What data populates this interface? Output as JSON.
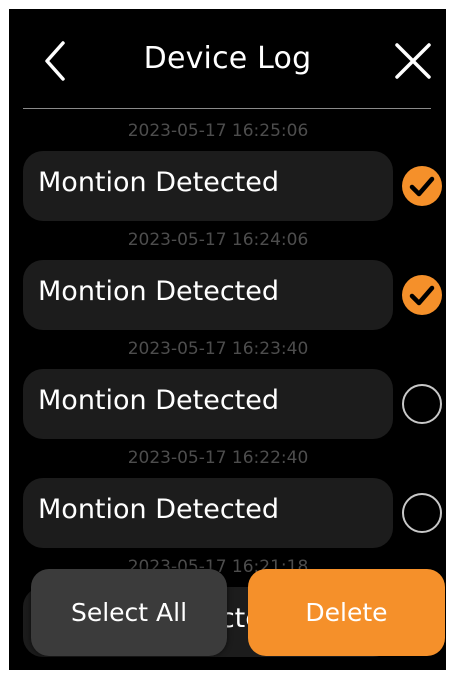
{
  "header": {
    "title": "Device Log",
    "back_icon": "chevron-left-icon",
    "close_icon": "close-icon"
  },
  "log_entries": [
    {
      "timestamp": "2023-05-17 16:25:06",
      "event": "Montion Detected",
      "selected": true
    },
    {
      "timestamp": "2023-05-17 16:24:06",
      "event": "Montion Detected",
      "selected": true
    },
    {
      "timestamp": "2023-05-17 16:23:40",
      "event": "Montion Detected",
      "selected": false
    },
    {
      "timestamp": "2023-05-17 16:22:40",
      "event": "Montion Detected",
      "selected": false
    },
    {
      "timestamp": "2023-05-17 16:21:18",
      "event": "Montion Detected",
      "selected": false
    }
  ],
  "actions": {
    "select_all_label": "Select All",
    "delete_label": "Delete"
  },
  "colors": {
    "background": "#000000",
    "card": "#1c1c1c",
    "accent": "#f5902a",
    "timestamp": "#4d4d4d",
    "secondary_button": "#3b3b3b"
  }
}
